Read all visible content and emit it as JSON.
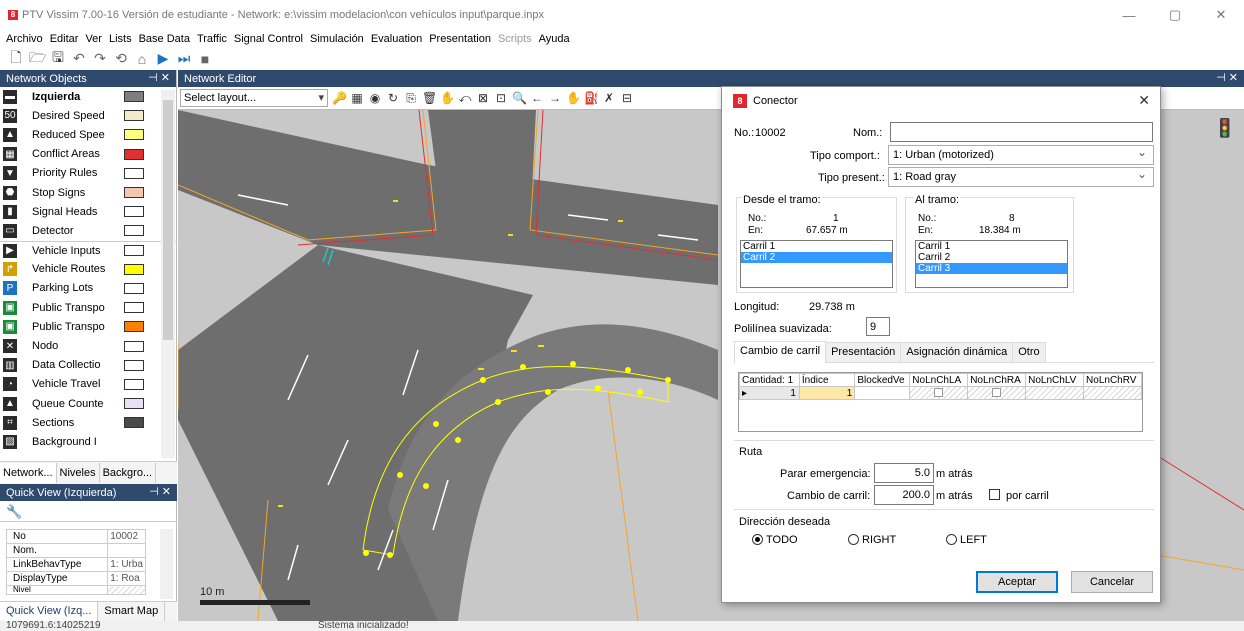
{
  "app": {
    "title": "PTV Vissim 7.00-16 Versión de estudiante - Network: e:\\vissim modelacion\\con vehículos input\\parque.inpx",
    "icon_glyph": "8",
    "win_minimize": "—",
    "win_maximize": "▢",
    "win_close": "✕"
  },
  "menu": [
    "Archivo",
    "Editar",
    "Ver",
    "Lists",
    "Base Data",
    "Traffic",
    "Signal Control",
    "Simulación",
    "Evaluation",
    "Presentation",
    "Scripts",
    "Ayuda"
  ],
  "menu_disabled": "Scripts",
  "toolbar": [
    "new-file",
    "open-folder",
    "save",
    "undo",
    "redo",
    "network",
    "zoom",
    "play",
    "step",
    "stop"
  ],
  "toolbar_glyphs": {
    "new": "🗋",
    "open": "🗁",
    "save": "🖫",
    "undo": "↶",
    "redo": "↷",
    "net": "⟲",
    "zoom": "⌂",
    "play": "▶",
    "step": "⏭",
    "stop": "■"
  },
  "network_objects": {
    "header": "Network Objects",
    "header_ctrls": "⊣ ✕",
    "items": [
      {
        "label": "Izquierda",
        "icon": "link-icon",
        "selected": true,
        "swatch": "#7f7f7f"
      },
      {
        "label": "Desired Speed",
        "icon": "speed-50-icon",
        "swatch": "#f4e9c8"
      },
      {
        "label": "Reduced Spee",
        "icon": "reduced-speed-icon",
        "swatch": "#ffff80"
      },
      {
        "label": "Conflict Areas",
        "icon": "conflict-areas-icon",
        "swatch": "#e03030"
      },
      {
        "label": "Priority Rules",
        "icon": "priority-rules-icon",
        "swatch": "#ffffff"
      },
      {
        "label": "Stop Signs",
        "icon": "stop-sign-icon",
        "swatch": "#f3c7b0"
      },
      {
        "label": "Signal Heads",
        "icon": "signal-heads-icon",
        "swatch": "#ffffff"
      },
      {
        "label": "Detector",
        "icon": "detector-icon",
        "swatch": "#ffffff"
      },
      {
        "label": "Vehicle Inputs",
        "icon": "vehicle-inputs-icon",
        "swatch": "#ffffff"
      },
      {
        "label": "Vehicle Routes",
        "icon": "vehicle-routes-icon",
        "swatch": "#ffff00"
      },
      {
        "label": "Parking Lots",
        "icon": "parking-lots-icon",
        "swatch": "#ffffff"
      },
      {
        "label": "Public Transpo",
        "icon": "public-transport-stops-icon",
        "swatch": "#ffffff"
      },
      {
        "label": "Public Transpo",
        "icon": "public-transport-lines-icon",
        "swatch": "#ff8000"
      },
      {
        "label": "Nodo",
        "icon": "node-icon",
        "swatch": "#ffffff"
      },
      {
        "label": "Data Collectio",
        "icon": "data-collection-icon",
        "swatch": "#ffffff"
      },
      {
        "label": "Vehicle Travel",
        "icon": "vehicle-travel-icon",
        "swatch": "#ffffff"
      },
      {
        "label": "Queue Counte",
        "icon": "queue-counter-icon",
        "swatch": "#e8e0f4"
      },
      {
        "label": "Sections",
        "icon": "sections-icon",
        "swatch": "#4a4a4a"
      },
      {
        "label": "Background I",
        "icon": "background-image-icon",
        "swatch": ""
      }
    ],
    "tabs": [
      "Network...",
      "Niveles",
      "Backgro..."
    ]
  },
  "quick_view": {
    "header": "Quick View (Izquierda)",
    "header_ctrls": "⊣ ✕",
    "tool_icon": "🔧",
    "rows": [
      {
        "key": "No",
        "value": "10002"
      },
      {
        "key": "Nom.",
        "value": ""
      },
      {
        "key": "LinkBehavType",
        "value": "1: Urba"
      },
      {
        "key": "DisplayType",
        "value": "1: Roa"
      },
      {
        "key": "Nivel",
        "value": ""
      }
    ],
    "tabs": [
      "Quick View (Izq...",
      "Smart Map"
    ]
  },
  "editor": {
    "header": "Network Editor",
    "header_ctrls": "⊣ ✕",
    "layout_placeholder": "Select layout...",
    "scale_label": "10 m",
    "tools": [
      "🔑",
      "▦",
      "◉",
      "↻",
      "⎘",
      "🗑",
      "✋",
      "⤺",
      "⊠",
      "⊡",
      "🔍",
      "←",
      "→",
      "✋",
      "⛽",
      "✗",
      "⊟"
    ]
  },
  "dialog": {
    "title": "Conector",
    "close": "✕",
    "no_label": "No.:",
    "no_value": "10002",
    "name_label": "Nom.:",
    "name_value": "",
    "behavior_label": "Tipo comport.:",
    "behavior_value": "1: Urban (motorized)",
    "display_label": "Tipo present.:",
    "display_value": "1: Road gray",
    "from_link": {
      "title": "Desde el tramo:",
      "no_label": "No.:",
      "no_value": "1",
      "at_label": "En:",
      "at_value": "67.657 m",
      "lanes": [
        "Carril 1",
        "Carril 2"
      ],
      "selected_lane": "Carril 2"
    },
    "to_link": {
      "title": "Al tramo:",
      "no_label": "No.:",
      "no_value": "8",
      "at_label": "En:",
      "at_value": "18.384 m",
      "lanes": [
        "Carril 1",
        "Carril 2",
        "Carril 3"
      ],
      "selected_lane": "Carril 3"
    },
    "length_label": "Longitud:",
    "length_value": "29.738 m",
    "spline_label": "Polilínea suavizada:",
    "spline_value": "9",
    "tabs": [
      "Cambio de carril",
      "Presentación",
      "Asignación dinámica",
      "Otro"
    ],
    "grid": {
      "headers": [
        "Cantidad: 1",
        "Índice",
        "BlockedVe",
        "NoLnChLA",
        "NoLnChRA",
        "NoLnChLV",
        "NoLnChRV"
      ],
      "row": {
        "marker": "▸",
        "num": "1",
        "index": "1"
      }
    },
    "route_title": "Ruta",
    "emergency_label": "Parar emergencia:",
    "emergency_value": "5.0",
    "emergency_unit": "m  atrás",
    "lanechange_label": "Cambio de carril:",
    "lanechange_value": "200.0",
    "lanechange_unit": "m  atrás",
    "per_lane_label": "por carril",
    "direction_title": "Dirección deseada",
    "dir_all": "TODO",
    "dir_right": "RIGHT",
    "dir_left": "LEFT",
    "ok_label": "Aceptar",
    "cancel_label": "Cancelar"
  },
  "status": {
    "coords": "1079691.6:14025219",
    "message": "Sistema inicializado!"
  },
  "colors": {
    "panel_header": "#2f4a6d",
    "road": "#6e6e6e",
    "ground": "#c8c8c8",
    "connector": "#ffff00",
    "selection": "#3399ff"
  }
}
